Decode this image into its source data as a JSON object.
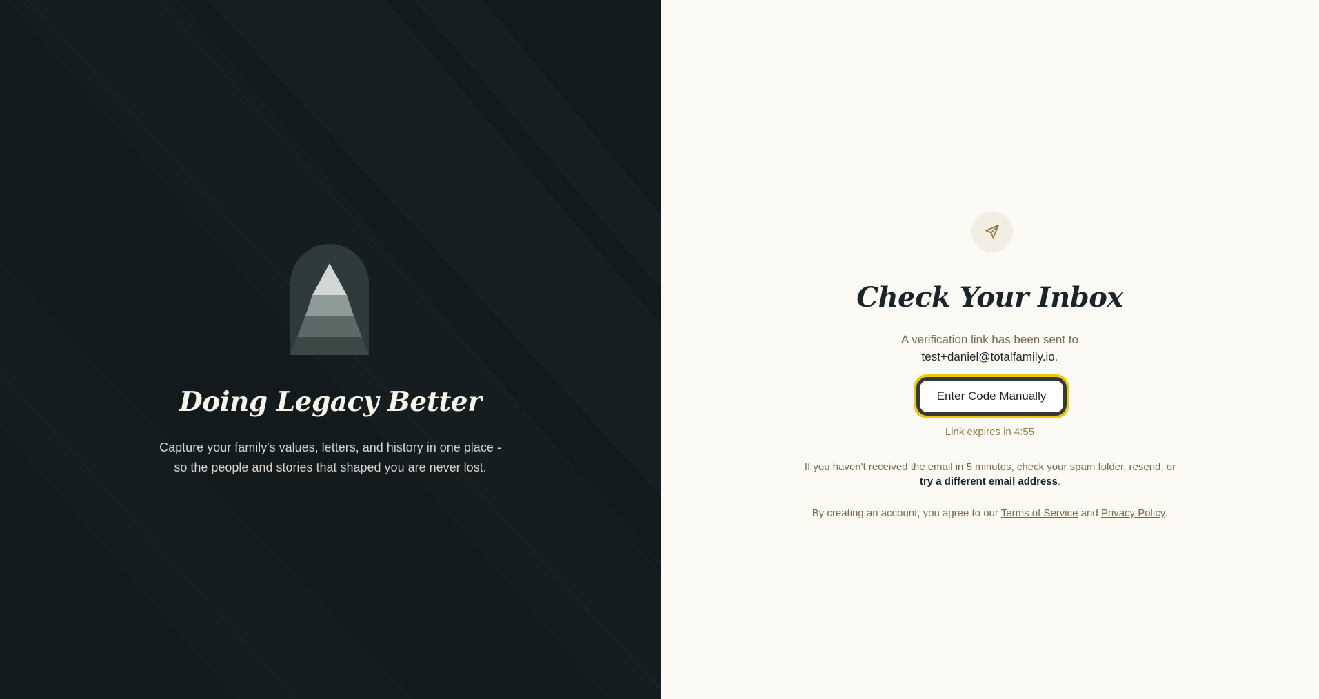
{
  "left": {
    "title": "Doing Legacy Better",
    "subtitle_line1": "Capture your family's values, letters, and history in one place -",
    "subtitle_line2": "so the people and stories that shaped you are never lost.",
    "logo_icon": "tree-arch-logo"
  },
  "right": {
    "icon": "paper-plane-send-icon",
    "title": "Check Your Inbox",
    "verify_line": "A verification link has been sent to",
    "email": "test+daniel@totalfamily.io",
    "email_suffix": ".",
    "enter_code_label": "Enter Code Manually",
    "link_expires": "Link expires in 4:55",
    "help_prefix": "If you haven't received the email in 5 minutes, check your spam folder, ",
    "resend_label": "resend",
    "help_middle": ", or",
    "different_email_label": "try a different email address",
    "help_suffix": ".",
    "agree_prefix": "By creating an account, you agree to our ",
    "terms_label": "Terms of Service",
    "agree_and": " and ",
    "privacy_label": "Privacy Policy",
    "agree_suffix": "."
  },
  "colors": {
    "left_bg": "#131a1c",
    "right_bg": "#fbfaf5",
    "focus_ring": "#f0c70f",
    "accent_gold": "#9a7a3e",
    "text_dark": "#1b2529"
  }
}
